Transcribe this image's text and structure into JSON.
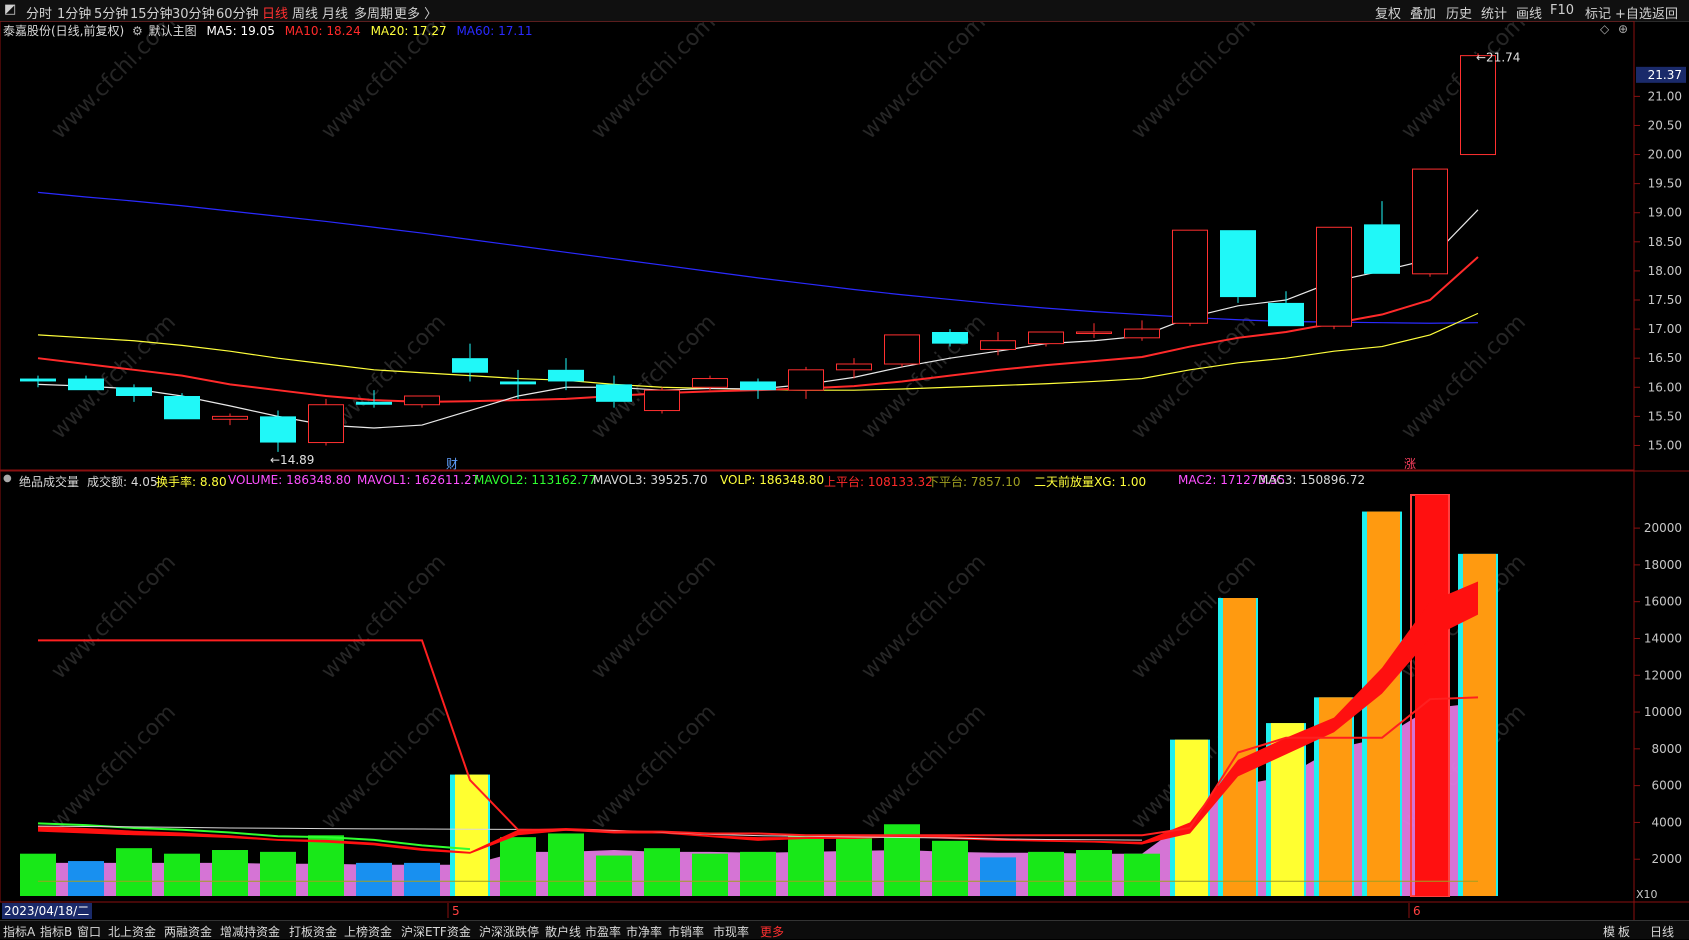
{
  "top_tabs": [
    "分时",
    "1分钟",
    "5分钟",
    "15分钟",
    "30分钟",
    "60分钟",
    "日线",
    "周线",
    "月线",
    "多周期",
    "更多 〉"
  ],
  "active_tab": "日线",
  "top_tools": [
    "复权",
    "叠加",
    "历史",
    "统计",
    "画线",
    "F10",
    "标记",
    "+自选",
    "返回"
  ],
  "price_panel": {
    "stock": "泰嘉股份(日线,前复权)",
    "indicator": "默认主图",
    "ma5": {
      "label": "MA5: 19.05",
      "color": "#ffffff"
    },
    "ma10": {
      "label": "MA10: 18.24",
      "color": "#ff2a2a"
    },
    "ma20": {
      "label": "MA20: 17.27",
      "color": "#ffff3c"
    },
    "ma60": {
      "label": "MA60: 17.11",
      "color": "#2a2aff"
    },
    "current_price": "21.37",
    "low_label": "←14.89",
    "high_label": "←21.74",
    "marker_cai": "财",
    "marker_zhang": "涨"
  },
  "volume_panel": {
    "items": [
      {
        "label": "绝品成交量",
        "color": "#d8d8d8"
      },
      {
        "label": "成交额: 4.05",
        "color": "#d8d8d8"
      },
      {
        "label": "换手率: 8.80",
        "color": "#ffff3c"
      },
      {
        "label": "VOLUME: 186348.80",
        "color": "#ff50ff"
      },
      {
        "label": "MAVOL1: 162611.27",
        "color": "#ff50ff"
      },
      {
        "label": "MAVOL2: 113162.77",
        "color": "#30ff30"
      },
      {
        "label": "MAVOL3: 39525.70",
        "color": "#d8d8d8"
      },
      {
        "label": "VOLP: 186348.80",
        "color": "#ffff3c"
      },
      {
        "label": "上平台: 108133.32",
        "color": "#ff2a2a"
      },
      {
        "label": "下平台: 7857.10",
        "color": "#a0a020"
      },
      {
        "label": "二天前放量XG: 1.00",
        "color": "#ffff3c"
      },
      {
        "label": "MAC2: 171273.55",
        "color": "#ff50ff"
      },
      {
        "label": "MAC3: 150896.72",
        "color": "#d8d8d8"
      }
    ],
    "unit": "X10"
  },
  "date_label": "2023/04/18/二",
  "month_marks": [
    "5",
    "6"
  ],
  "bottom_buttons": [
    "指标A",
    "指标B",
    "窗口",
    "北上资金",
    "两融资金",
    "增减持资金",
    "打板资金",
    "上榜资金",
    "沪深ETF资金",
    "沪深涨跌停",
    "散户线",
    "市盈率",
    "市净率",
    "市销率",
    "市现率",
    "更多"
  ],
  "bottom_right": [
    "模",
    "板",
    "日线"
  ],
  "chart_data": [
    {
      "type": "candlestick",
      "title": "泰嘉股份(日线,前复权)",
      "y_ticks": [
        15.0,
        15.5,
        16.0,
        16.5,
        17.0,
        17.5,
        18.0,
        18.5,
        19.0,
        19.5,
        20.0,
        20.5,
        21.0
      ],
      "ylim": [
        14.75,
        21.9
      ],
      "candles": [
        {
          "o": 16.15,
          "h": 16.2,
          "l": 16.0,
          "c": 16.1
        },
        {
          "o": 16.15,
          "h": 16.2,
          "l": 15.95,
          "c": 15.95
        },
        {
          "o": 16.0,
          "h": 16.05,
          "l": 15.75,
          "c": 15.85
        },
        {
          "o": 15.85,
          "h": 15.9,
          "l": 15.45,
          "c": 15.45
        },
        {
          "o": 15.45,
          "h": 15.55,
          "l": 15.35,
          "c": 15.5
        },
        {
          "o": 15.5,
          "h": 15.6,
          "l": 14.89,
          "c": 15.05
        },
        {
          "o": 15.05,
          "h": 15.8,
          "l": 15.0,
          "c": 15.7
        },
        {
          "o": 15.75,
          "h": 15.95,
          "l": 15.65,
          "c": 15.7
        },
        {
          "o": 15.7,
          "h": 15.85,
          "l": 15.65,
          "c": 15.85
        },
        {
          "o": 16.5,
          "h": 16.75,
          "l": 16.1,
          "c": 16.25
        },
        {
          "o": 16.1,
          "h": 16.3,
          "l": 15.8,
          "c": 16.05
        },
        {
          "o": 16.3,
          "h": 16.5,
          "l": 15.95,
          "c": 16.1
        },
        {
          "o": 16.05,
          "h": 16.2,
          "l": 15.65,
          "c": 15.75
        },
        {
          "o": 15.6,
          "h": 16.0,
          "l": 15.55,
          "c": 15.95
        },
        {
          "o": 16.0,
          "h": 16.2,
          "l": 15.95,
          "c": 16.15
        },
        {
          "o": 16.1,
          "h": 16.15,
          "l": 15.8,
          "c": 15.95
        },
        {
          "o": 15.95,
          "h": 16.35,
          "l": 15.8,
          "c": 16.3
        },
        {
          "o": 16.3,
          "h": 16.5,
          "l": 16.15,
          "c": 16.4
        },
        {
          "o": 16.4,
          "h": 16.9,
          "l": 16.35,
          "c": 16.9
        },
        {
          "o": 16.95,
          "h": 17.0,
          "l": 16.7,
          "c": 16.75
        },
        {
          "o": 16.65,
          "h": 16.95,
          "l": 16.55,
          "c": 16.8
        },
        {
          "o": 16.75,
          "h": 16.95,
          "l": 16.7,
          "c": 16.95
        },
        {
          "o": 16.95,
          "h": 17.1,
          "l": 16.85,
          "c": 16.95
        },
        {
          "o": 16.85,
          "h": 17.15,
          "l": 16.8,
          "c": 17.0
        },
        {
          "o": 17.1,
          "h": 18.7,
          "l": 17.05,
          "c": 18.7
        },
        {
          "o": 18.7,
          "h": 18.7,
          "l": 17.45,
          "c": 17.55
        },
        {
          "o": 17.45,
          "h": 17.65,
          "l": 17.05,
          "c": 17.05
        },
        {
          "o": 17.05,
          "h": 18.75,
          "l": 17.0,
          "c": 18.75
        },
        {
          "o": 18.8,
          "h": 19.2,
          "l": 17.95,
          "c": 17.95
        },
        {
          "o": 17.95,
          "h": 19.75,
          "l": 17.9,
          "c": 19.75
        },
        {
          "o": 20.0,
          "h": 21.74,
          "l": 20.0,
          "c": 21.7
        }
      ],
      "ma5": [
        16.05,
        16.02,
        15.97,
        15.85,
        15.68,
        15.5,
        15.35,
        15.3,
        15.35,
        15.6,
        15.85,
        16.0,
        16.0,
        15.95,
        15.98,
        15.97,
        16.05,
        16.17,
        16.35,
        16.5,
        16.62,
        16.75,
        16.8,
        16.88,
        17.2,
        17.4,
        17.5,
        17.82,
        18.0,
        18.2,
        19.05
      ],
      "ma10": [
        16.5,
        16.4,
        16.3,
        16.2,
        16.05,
        15.95,
        15.85,
        15.78,
        15.75,
        15.76,
        15.78,
        15.8,
        15.85,
        15.9,
        15.93,
        15.95,
        15.98,
        16.02,
        16.1,
        16.2,
        16.3,
        16.38,
        16.45,
        16.52,
        16.7,
        16.85,
        16.95,
        17.1,
        17.25,
        17.5,
        18.24
      ],
      "ma20": [
        16.9,
        16.85,
        16.8,
        16.72,
        16.62,
        16.5,
        16.4,
        16.3,
        16.25,
        16.2,
        16.15,
        16.12,
        16.05,
        16.0,
        15.98,
        15.96,
        15.95,
        15.95,
        15.97,
        16.0,
        16.03,
        16.06,
        16.1,
        16.15,
        16.3,
        16.42,
        16.5,
        16.62,
        16.7,
        16.9,
        17.27
      ],
      "ma60": [
        19.35,
        19.27,
        19.2,
        19.12,
        19.03,
        18.94,
        18.85,
        18.75,
        18.65,
        18.54,
        18.43,
        18.32,
        18.21,
        18.1,
        17.99,
        17.88,
        17.78,
        17.68,
        17.59,
        17.51,
        17.43,
        17.36,
        17.3,
        17.25,
        17.2,
        17.16,
        17.13,
        17.12,
        17.11,
        17.1,
        17.11
      ]
    },
    {
      "type": "bar",
      "title": "绝品成交量",
      "y_ticks": [
        2000,
        4000,
        6000,
        8000,
        10000,
        12000,
        14000,
        16000,
        18000,
        20000
      ],
      "ylim": [
        0,
        21800
      ],
      "values": [
        2300,
        1900,
        2600,
        2300,
        2500,
        2400,
        3300,
        1800,
        1800,
        6600,
        3200,
        3400,
        2200,
        2600,
        2300,
        2400,
        3300,
        3300,
        3900,
        3000,
        2100,
        2400,
        2500,
        2300,
        8500,
        16200,
        9400,
        10800,
        20900,
        21800,
        18600
      ],
      "bar_colors": [
        "green",
        "blue",
        "green",
        "green",
        "green",
        "green",
        "green",
        "blue",
        "blue",
        "yellow",
        "green",
        "green",
        "green",
        "green",
        "green",
        "green",
        "green",
        "green",
        "green",
        "green",
        "blue",
        "green",
        "green",
        "green",
        "yellow",
        "orange",
        "yellow",
        "orange",
        "orange",
        "red",
        "orange"
      ],
      "mac_line": [
        1800,
        1800,
        1800,
        1800,
        1800,
        1750,
        1750,
        1700,
        1700,
        1700,
        2400,
        2400,
        2500,
        2400,
        2400,
        2350,
        2400,
        2450,
        2500,
        2400,
        2350,
        2350,
        2300,
        2300,
        4200,
        6000,
        6500,
        8000,
        8600,
        10200,
        10500
      ],
      "mavol_band": [
        [
          3500,
          3800
        ],
        [
          3400,
          3700
        ],
        [
          3300,
          3550
        ],
        [
          3250,
          3450
        ],
        [
          3150,
          3300
        ],
        [
          3000,
          3100
        ],
        [
          2900,
          3050
        ],
        [
          2750,
          2900
        ],
        [
          2450,
          2600
        ],
        [
          2300,
          2400
        ],
        [
          3300,
          3600
        ],
        [
          3550,
          3700
        ],
        [
          3400,
          3600
        ],
        [
          3400,
          3500
        ],
        [
          3200,
          3300
        ],
        [
          3000,
          3200
        ],
        [
          3100,
          3200
        ],
        [
          3100,
          3300
        ],
        [
          3200,
          3350
        ],
        [
          3100,
          3250
        ],
        [
          3000,
          3150
        ],
        [
          2950,
          3050
        ],
        [
          2900,
          3000
        ],
        [
          2800,
          2950
        ],
        [
          3400,
          4000
        ],
        [
          6500,
          7400
        ],
        [
          7700,
          8600
        ],
        [
          8900,
          9700
        ],
        [
          11000,
          12400
        ],
        [
          14000,
          16000
        ],
        [
          15300,
          17100
        ]
      ],
      "upper_platform": [
        13900,
        13900,
        13900,
        13900,
        13900,
        13900,
        13900,
        13900,
        13900,
        6300,
        3600,
        3600,
        3500,
        3500,
        3400,
        3400,
        3300,
        3300,
        3300,
        3300,
        3300,
        3300,
        3300,
        3300,
        3700,
        7800,
        8600,
        8600,
        8600,
        10700,
        10800
      ],
      "lower_platform": [
        800,
        800,
        800,
        800,
        800,
        800,
        800,
        800,
        800,
        800,
        800,
        800,
        800,
        800,
        800,
        800,
        800,
        800,
        800,
        800,
        800,
        800,
        800,
        800,
        800,
        800,
        800,
        800,
        800,
        800,
        800
      ],
      "mavol3_line": [
        3800,
        3780,
        3760,
        3730,
        3700,
        3680,
        3660,
        3650,
        3640,
        3630,
        3620,
        3600,
        3560,
        3460,
        3350,
        3280,
        3250,
        3210,
        3180,
        3150,
        3100,
        3070,
        3060,
        3040,
        null,
        null,
        null,
        null,
        null,
        null,
        null
      ]
    }
  ]
}
